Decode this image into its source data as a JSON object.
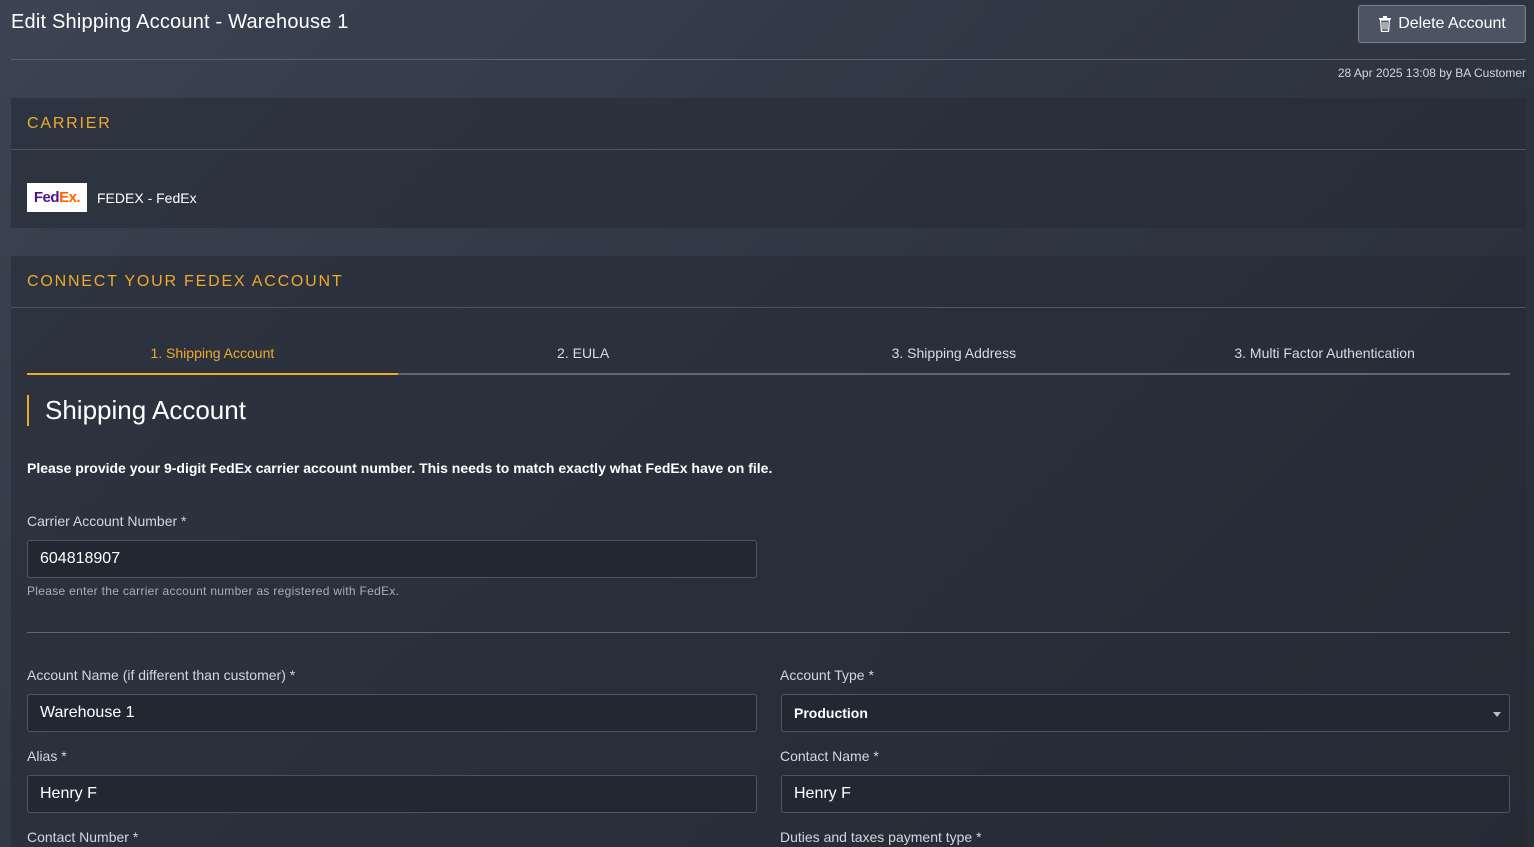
{
  "header": {
    "title": "Edit Shipping Account - Warehouse 1",
    "delete_label": "Delete Account",
    "timestamp": "28 Apr 2025 13:08 by BA Customer"
  },
  "carrier": {
    "heading": "CARRIER",
    "logo_text_fed": "Fed",
    "logo_text_ex": "Ex",
    "logo_dot": ".",
    "name": "FEDEX - FedEx"
  },
  "connect": {
    "heading": "CONNECT YOUR FEDEX ACCOUNT",
    "tabs": [
      {
        "label": "1. Shipping Account",
        "active": true
      },
      {
        "label": "2. EULA",
        "active": false
      },
      {
        "label": "3. Shipping Address",
        "active": false
      },
      {
        "label": "3. Multi Factor Authentication",
        "active": false
      }
    ],
    "section_title": "Shipping Account",
    "instructions": "Please provide your 9-digit FedEx carrier account number. This needs to match exactly what FedEx have on file."
  },
  "form": {
    "carrier_account_number": {
      "label": "Carrier Account Number *",
      "value": "604818907",
      "help": "Please enter the carrier account number as registered with FedEx."
    },
    "account_name": {
      "label": "Account Name (if different than customer) *",
      "value": "Warehouse 1"
    },
    "account_type": {
      "label": "Account Type *",
      "value": "Production"
    },
    "alias": {
      "label": "Alias *",
      "value": "Henry F"
    },
    "contact_name": {
      "label": "Contact Name *",
      "value": "Henry F"
    },
    "contact_number": {
      "label": "Contact Number *"
    },
    "duties_taxes": {
      "label": "Duties and taxes payment type *"
    }
  },
  "colors": {
    "accent": "#f0a92b",
    "fedex_purple": "#4d148c",
    "fedex_orange": "#ff6200"
  }
}
